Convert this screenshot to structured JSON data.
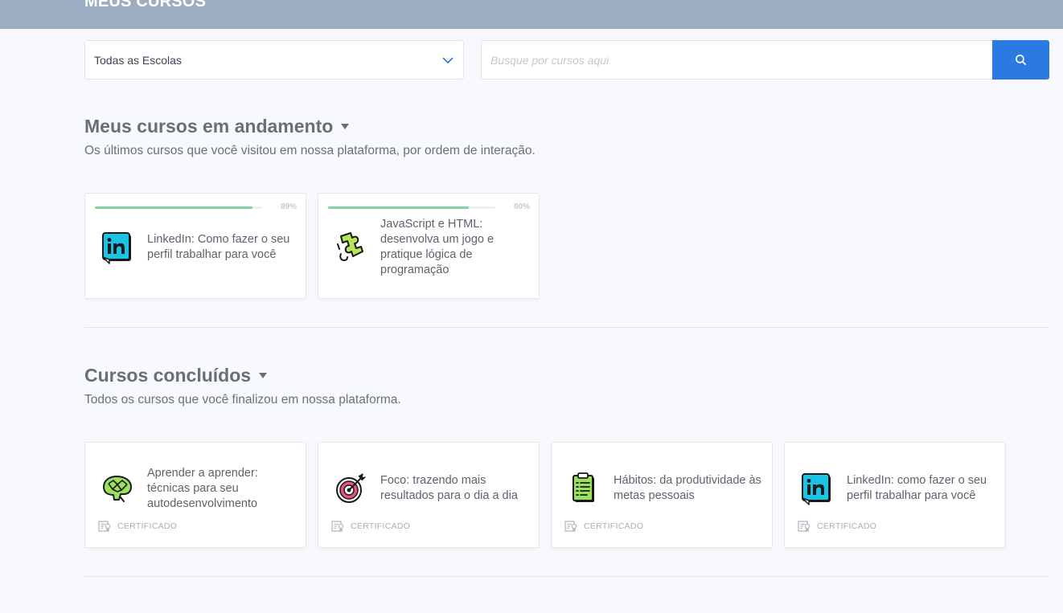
{
  "header": {
    "title": "MEUS CURSOS"
  },
  "filters": {
    "school_select": {
      "value": "Todas as Escolas"
    },
    "search": {
      "placeholder": "Busque por cursos aqui",
      "button_icon": "search-icon"
    }
  },
  "in_progress": {
    "title": "Meus cursos em andamento",
    "description": "Os últimos cursos que você visitou em nossa plataforma, por ordem de interação.",
    "courses": [
      {
        "title": "LinkedIn: Como fazer o seu perfil trabalhar para você",
        "progress": 89,
        "progress_label": "89%",
        "icon": "linkedin-icon"
      },
      {
        "title": "JavaScript e HTML: desenvolva um jogo e pratique lógica de programação",
        "progress": 80,
        "progress_label": "80%",
        "icon": "puzzle-piece-icon"
      }
    ]
  },
  "completed": {
    "title": "Cursos concluídos",
    "description": "Todos os cursos que você finalizou em nossa plataforma.",
    "courses": [
      {
        "title": "Aprender a aprender: técnicas para seu autodesenvolvimento",
        "certificate_label": "CERTIFICADO",
        "icon": "brain-icon"
      },
      {
        "title": "Foco: trazendo mais resultados para o dia a dia",
        "certificate_label": "CERTIFICADO",
        "icon": "target-icon"
      },
      {
        "title": "Hábitos: da produtividade às metas pessoais",
        "certificate_label": "CERTIFICADO",
        "icon": "clipboard-icon"
      },
      {
        "title": "LinkedIn: como fazer o seu perfil trabalhar para você",
        "certificate_label": "CERTIFICADO",
        "icon": "linkedin-icon"
      }
    ]
  },
  "colors": {
    "header_bg": "#9dadc1",
    "accent": "#2a7ae2",
    "progress": "#7fd6a0"
  }
}
